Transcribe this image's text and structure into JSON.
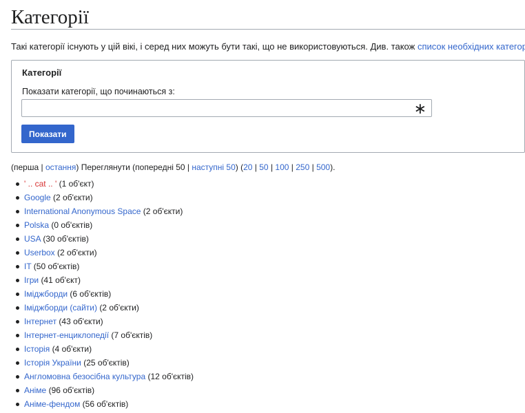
{
  "page_title": "Категорії",
  "intro": {
    "text": "Такі категорії існують у цій вікі, і серед них можуть бути такі, що не використовуються. Див. також ",
    "link": "список необхідних категорій",
    "end": "."
  },
  "form": {
    "legend": "Категорії",
    "label": "Показати категорії, що починаються з:",
    "input_value": "",
    "input_placeholder": "",
    "clear_icon": "asterisk-icon",
    "submit_label": "Показати"
  },
  "nav": {
    "open": "(",
    "first": "перша",
    "sep1": " | ",
    "last": "остання",
    "browse": ") Переглянути (попередні 50 | ",
    "next": "наступні 50",
    "paren_mid": ") (",
    "limits": [
      "20",
      "50",
      "100",
      "250",
      "500"
    ],
    "limit_sep": " | ",
    "close": ")."
  },
  "categories": [
    {
      "name": "' .. cat .. '",
      "count": "(1 об'єкт)",
      "red": true
    },
    {
      "name": "Google",
      "count": "(2 об'єкти)"
    },
    {
      "name": "International Anonymous Space",
      "count": "(2 об'єкти)"
    },
    {
      "name": "Polska",
      "count": "(0 об'єктів)"
    },
    {
      "name": "USA",
      "count": "(30 об'єктів)"
    },
    {
      "name": "Userbox",
      "count": "(2 об'єкти)"
    },
    {
      "name": "IT",
      "count": "(50 об'єктів)"
    },
    {
      "name": "Ігри",
      "count": "(41 об'єкт)"
    },
    {
      "name": "Іміджборди",
      "count": "(6 об'єктів)"
    },
    {
      "name": "Іміджборди (сайти)",
      "count": "(2 об'єкти)"
    },
    {
      "name": "Інтернет",
      "count": "(43 об'єкти)"
    },
    {
      "name": "Інтернет-енциклопедії",
      "count": "(7 об'єктів)"
    },
    {
      "name": "Історія",
      "count": "(4 об'єкти)"
    },
    {
      "name": "Історія України",
      "count": "(25 об'єктів)"
    },
    {
      "name": "Англомовна безосібна культура",
      "count": "(12 об'єктів)"
    },
    {
      "name": "Аніме",
      "count": "(96 об'єктів)"
    },
    {
      "name": "Аніме-фендом",
      "count": "(56 об'єктів)"
    }
  ],
  "colors": {
    "link": "#3366cc",
    "redlink": "#d73333",
    "button": "#3366cc"
  }
}
